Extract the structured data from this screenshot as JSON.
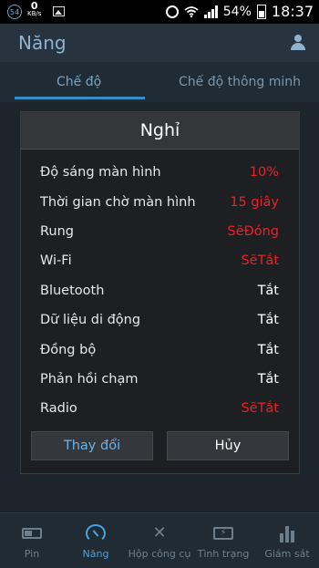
{
  "status_bar": {
    "notif_count": "54",
    "net_speed": "0",
    "net_unit": "KB/s",
    "battery": "54%",
    "time": "18:37"
  },
  "header": {
    "title": "Năng"
  },
  "tabs": [
    {
      "label": "Chế độ",
      "active": true
    },
    {
      "label": "Chế độ thông minh",
      "active": false
    }
  ],
  "dialog": {
    "title": "Nghỉ",
    "rows": [
      {
        "label": "Độ sáng màn hình",
        "value": "10%",
        "highlight": true
      },
      {
        "label": "Thời gian chờ màn hình",
        "value": "15 giây",
        "highlight": true
      },
      {
        "label": "Rung",
        "value": "SẽĐóng",
        "highlight": true
      },
      {
        "label": "Wi-Fi",
        "value": "SẽTắt",
        "highlight": true
      },
      {
        "label": "Bluetooth",
        "value": "Tắt",
        "highlight": false
      },
      {
        "label": "Dữ liệu di động",
        "value": "Tắt",
        "highlight": false
      },
      {
        "label": "Đồng bộ",
        "value": "Tắt",
        "highlight": false
      },
      {
        "label": "Phản hồi chạm",
        "value": "Tắt",
        "highlight": false
      },
      {
        "label": "Radio",
        "value": "SẽTắt",
        "highlight": true
      }
    ],
    "confirm_label": "Thay đổi",
    "cancel_label": "Hủy"
  },
  "bottom_nav": [
    {
      "label": "Pin",
      "icon": "battery-icon",
      "active": false
    },
    {
      "label": "Năng",
      "icon": "gauge-icon",
      "active": true
    },
    {
      "label": "Hộp công cụ",
      "icon": "tools-icon",
      "active": false
    },
    {
      "label": "Tình trạng",
      "icon": "charging-icon",
      "active": false
    },
    {
      "label": "Giám sát",
      "icon": "bar-chart-icon",
      "active": false
    }
  ],
  "colors": {
    "accent": "#4aa3e0",
    "highlight": "#e6222b"
  }
}
